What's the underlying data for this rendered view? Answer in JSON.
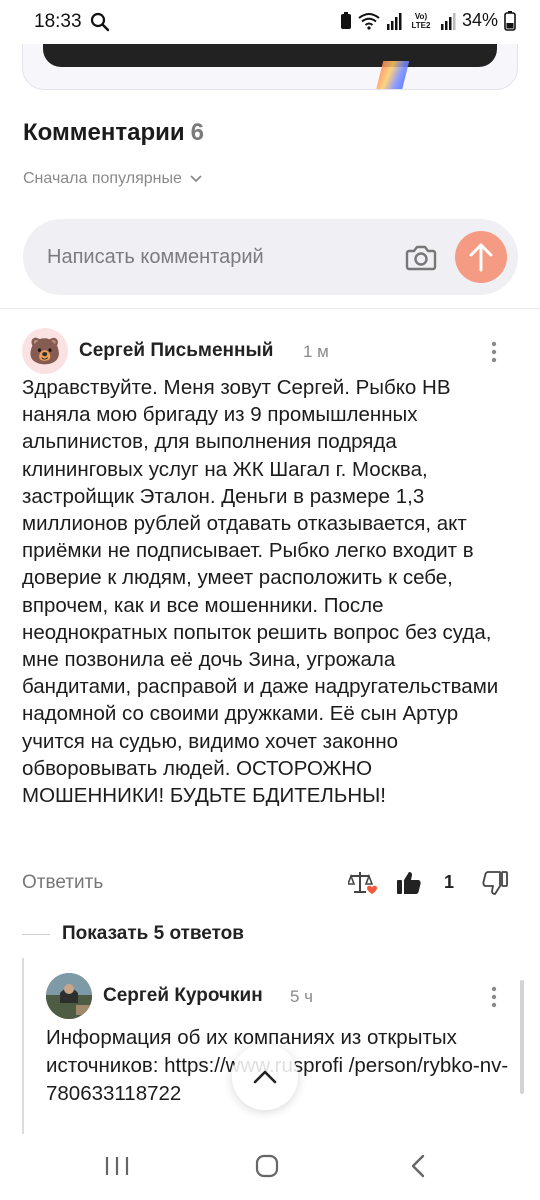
{
  "status_bar": {
    "time": "18:33",
    "battery": "34%",
    "network": "Vo) LTE2"
  },
  "comments": {
    "title": "Комментарии",
    "count": "6",
    "sort_label": "Сначала популярные",
    "input_placeholder": "Написать комментарий"
  },
  "comment_main": {
    "author": "Сергей Письменный",
    "time": "1 м",
    "avatar_emoji": "🐻",
    "text": "Здравствуйте. Меня зовут Сергей. Рыбко НВ наняла мою бригаду из 9 промышленных альпинистов, для выполнения подряда клининговых услуг на ЖК Шагал г. Москва, застройщик Эталон. Деньги в размере 1,3 миллионов рублей отдавать отказывается, акт приёмки не подписывает. Рыбко легко входит в доверие к людям, умеет расположить к себе, впрочем, как и все мошенники. После неоднократных попыток решить вопрос без суда, мне позвонила её дочь Зина, угрожала бандитами, расправой и даже надругательствами надомной со своими дружками. Её сын Артур учится на судью, видимо хочет законно обворовывать людей. ОСТОРОЖНО МОШЕННИКИ! БУДЬТЕ БДИТЕЛЬНЫ!",
    "reply_label": "Ответить",
    "likes": "1"
  },
  "replies": {
    "show_label": "Показать 5 ответов"
  },
  "reply_first": {
    "author": "Сергей Курочкин",
    "time": "5 ч",
    "text": "Информация об их компаниях из открытых источников: https://www.rusprofi    /person/rybko-nv-780633118722"
  },
  "colors": {
    "accent": "#f59a83",
    "input_bg": "#f0f0f4",
    "muted_text": "#8a8a8a"
  },
  "icons": {
    "camera": "camera-icon",
    "send": "arrow-up-icon",
    "award": "scales-award-icon",
    "like": "thumbs-up-icon",
    "dislike": "thumbs-down-icon",
    "more": "more-vertical-icon",
    "scroll_top": "chevron-up-icon"
  }
}
